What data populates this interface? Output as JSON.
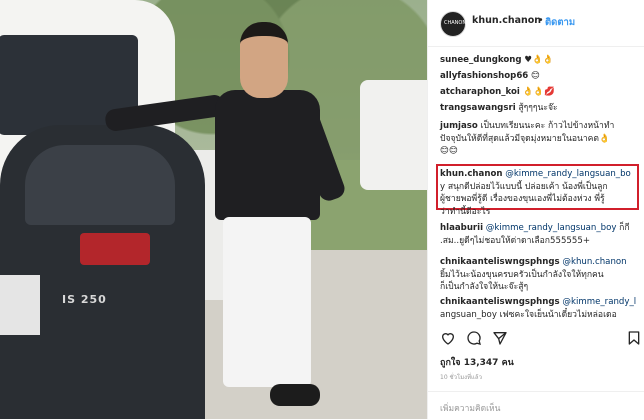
{
  "post": {
    "header": {
      "username": "khun.chanon",
      "separator": "•",
      "follow_label": "ติดตาม",
      "avatar_text": "CHANON"
    },
    "photo": {
      "car_badge": "IS 250"
    },
    "comments": [
      {
        "user": "sunee_dungkong",
        "text": " ♥👌👌"
      },
      {
        "user": "allyfashionshop66",
        "text": " 😊"
      },
      {
        "user": "atcharaphon_koi",
        "text": " 👌👌💋"
      },
      {
        "user": "trangsawangsri",
        "text": " สู้ๆๆๆนะจ๊ะ"
      },
      {
        "user": "jumjaso",
        "text": " เป็นบทเรียนนะคะ ก้าวไปข้างหน้าทำ",
        "lines": [
          "ปัจจุบันให้ดีที่สุดแล้วมีจุดมุ่งหมายในอนาคต👌",
          "😊😊"
        ]
      },
      {
        "user": "khun.chanon",
        "mention": " @kimme_randy_langsuan_bo",
        "lines": [
          "y สนุกดีปล่อยไว้แบบนี้ ปล่อยเค้า น้องพี่เป็นลูก",
          "ผู้ชายพอพี่รู้ดี เรื่องของขุนเองพี่ไม่ต้องห่วง พี่รู้",
          "ว่าทำนี้ดีอะไร"
        ]
      },
      {
        "user": "hlaaburii",
        "mention": " @kimme_randy_langsuan_boy",
        "tail": " ก็กี",
        "lines": [
          ".สม..ยูดีๆไม่ชอบให้ด่าดาเลือก555555+"
        ]
      },
      {
        "user": "chnikaanteliswngsphngs",
        "mention": " @khun.chanon",
        "lines": [
          "ยิ้มไว้นะน้องขุนครบครัวเป็นกำลังใจให้ทุกคน",
          "ก็เป็นกำลังใจให้นะจ๊ะสู้ๆ"
        ]
      },
      {
        "user": "chnikaanteliswngsphngs",
        "mention": " @kimme_randy_l",
        "lines": [
          "angsuan_boy เฟซคะใจเย็นน้าเดี๋ยวไม่หล่อเดอ"
        ]
      }
    ],
    "likes_label": "ถูกใจ 13,347 คน",
    "timestamp": "10 ชั่วโมงที่แล้ว",
    "add_comment_placeholder": "เพิ่มความคิดเห็น"
  }
}
